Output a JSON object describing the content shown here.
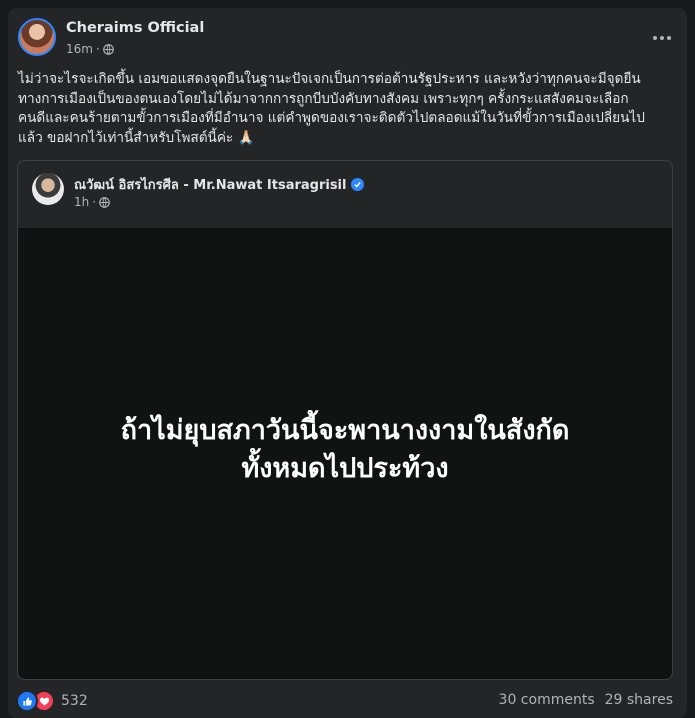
{
  "post": {
    "author": "Cheraims Official",
    "time": "16m",
    "caption": "ไม่ว่าจะไรจะเกิดขึ้น เอมขอแสดงจุดยืนในฐานะปัจเจกเป็นการต่อต้านรัฐประหาร และหวังว่าทุกคนจะมีจุดยืน\nทางการเมืองเป็นของตนเองโดยไม่ได้มาจากการถูกบีบบังคับทางสังคม เพราะทุกๆ ครั้งกระแสสังคมจะเลือก\nคนดีและคนร้ายตามขั้วการเมืองที่มีอำนาจ แต่คำพูดของเราจะติดตัวไปตลอดแม้ในวันที่ขั้วการเมืองเปลี่ยนไป\nแล้ว ขอฝากไว้เท่านี้สำหรับโพสต์นี้ค่ะ 🙏🏻"
  },
  "shared": {
    "author": "ณวัฒน์ อิสรไกรศีล - Mr.Nawat Itsaragrisil",
    "time": "1h",
    "video_line1": "ถ้าไม่ยุบสภาวันนี้จะพานางงามในสังกัด",
    "video_line2": "ทั้งหมดไปประท้วง"
  },
  "footer": {
    "reaction_count": "532",
    "comments": "30 comments",
    "shares": "29 shares"
  },
  "icons": {
    "privacy": "globe-icon",
    "more": "more-options-icon",
    "verified": "verified-badge-icon",
    "like": "like-reaction-icon",
    "love": "love-reaction-icon"
  },
  "colors": {
    "background": "#18191a",
    "card": "#242526",
    "accent": "#2d88ff",
    "like": "#2078f4",
    "love": "#f33e58"
  }
}
